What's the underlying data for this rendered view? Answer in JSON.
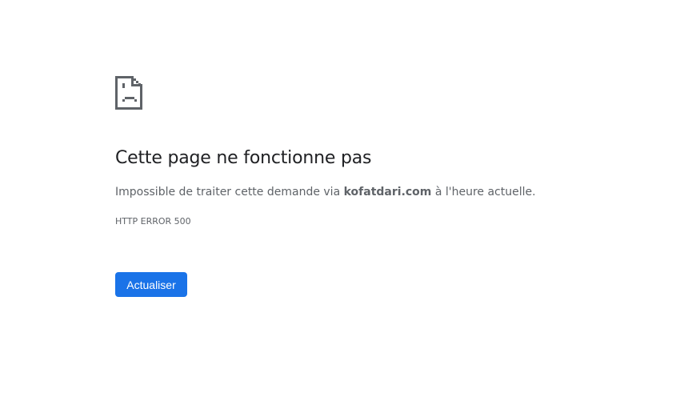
{
  "error": {
    "icon": "sad-page-icon",
    "title": "Cette page ne fonctionne pas",
    "message_prefix": "Impossible de traiter cette demande via ",
    "domain": "kofatdari.com",
    "message_suffix": " à l'heure actuelle.",
    "code": "HTTP ERROR 500",
    "reload_label": "Actualiser",
    "accent_color": "#1a73e8"
  }
}
